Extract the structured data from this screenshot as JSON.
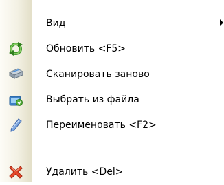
{
  "menu": {
    "items": [
      {
        "label": "Вид",
        "icon": "none",
        "has_submenu": true
      },
      {
        "label": "Обновить <F5>",
        "icon": "refresh-icon"
      },
      {
        "label": "Сканировать заново",
        "icon": "scanner-icon"
      },
      {
        "label": "Выбрать из файла",
        "icon": "open-file-icon"
      },
      {
        "label": "Переименовать <F2>",
        "icon": "rename-pen-icon"
      },
      {
        "label": "Удалить <Del>",
        "icon": "delete-icon"
      }
    ]
  },
  "colors": {
    "gutter_light": "#fdfcf7",
    "gutter_dark": "#e3dfc8",
    "separator": "#a6a499",
    "refresh_green": "#3f9b2a",
    "delete_red": "#e8482a"
  }
}
